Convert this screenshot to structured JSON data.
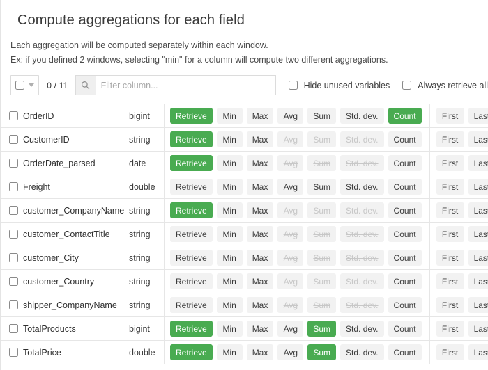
{
  "header": {
    "title": "Compute aggregations for each field",
    "subtitle_line1": "Each aggregation will be computed separately within each window.",
    "subtitle_line2": "Ex: if you defined 2 windows, selecting \"min\" for a column will compute two different aggregations."
  },
  "toolbar": {
    "select_all_checkbox_checked": false,
    "dropdown_icon": "chevron-down-icon",
    "count_label": "0 / 11",
    "search_icon": "search-icon",
    "search_placeholder": "Filter column...",
    "search_value": "",
    "hide_unused_label": "Hide unused variables",
    "hide_unused_checked": false,
    "always_retrieve_label": "Always retrieve all",
    "always_retrieve_checked": false
  },
  "colors": {
    "accent_green": "#49ab51",
    "button_bg": "#f2f2f2",
    "button_text": "#3b3b3b",
    "disabled_text": "#c7c7c7",
    "border": "#e6e6e6"
  },
  "action_labels": {
    "retrieve": "Retrieve",
    "min": "Min",
    "max": "Max",
    "avg": "Avg",
    "sum": "Sum",
    "std": "Std. dev.",
    "count": "Count",
    "first": "First",
    "last": "Last"
  },
  "rows": [
    {
      "name": "OrderID",
      "type": "bigint",
      "checked": false,
      "actions": {
        "retrieve": "selected",
        "min": "normal",
        "max": "normal",
        "avg": "normal",
        "sum": "normal",
        "std": "normal",
        "count": "selected",
        "first": "normal",
        "last": "normal"
      }
    },
    {
      "name": "CustomerID",
      "type": "string",
      "checked": false,
      "actions": {
        "retrieve": "selected",
        "min": "normal",
        "max": "normal",
        "avg": "disabled",
        "sum": "disabled",
        "std": "disabled",
        "count": "normal",
        "first": "normal",
        "last": "normal"
      }
    },
    {
      "name": "OrderDate_parsed",
      "type": "date",
      "checked": false,
      "actions": {
        "retrieve": "selected",
        "min": "normal",
        "max": "normal",
        "avg": "disabled",
        "sum": "disabled",
        "std": "disabled",
        "count": "normal",
        "first": "normal",
        "last": "normal"
      }
    },
    {
      "name": "Freight",
      "type": "double",
      "checked": false,
      "actions": {
        "retrieve": "normal",
        "min": "normal",
        "max": "normal",
        "avg": "normal",
        "sum": "normal",
        "std": "normal",
        "count": "normal",
        "first": "normal",
        "last": "normal"
      }
    },
    {
      "name": "customer_CompanyName",
      "type": "string",
      "checked": false,
      "actions": {
        "retrieve": "selected",
        "min": "normal",
        "max": "normal",
        "avg": "disabled",
        "sum": "disabled",
        "std": "disabled",
        "count": "normal",
        "first": "normal",
        "last": "normal"
      }
    },
    {
      "name": "customer_ContactTitle",
      "type": "string",
      "checked": false,
      "actions": {
        "retrieve": "normal",
        "min": "normal",
        "max": "normal",
        "avg": "disabled",
        "sum": "disabled",
        "std": "disabled",
        "count": "normal",
        "first": "normal",
        "last": "normal"
      }
    },
    {
      "name": "customer_City",
      "type": "string",
      "checked": false,
      "actions": {
        "retrieve": "normal",
        "min": "normal",
        "max": "normal",
        "avg": "disabled",
        "sum": "disabled",
        "std": "disabled",
        "count": "normal",
        "first": "normal",
        "last": "normal"
      }
    },
    {
      "name": "customer_Country",
      "type": "string",
      "checked": false,
      "actions": {
        "retrieve": "normal",
        "min": "normal",
        "max": "normal",
        "avg": "disabled",
        "sum": "disabled",
        "std": "disabled",
        "count": "normal",
        "first": "normal",
        "last": "normal"
      }
    },
    {
      "name": "shipper_CompanyName",
      "type": "string",
      "checked": false,
      "actions": {
        "retrieve": "normal",
        "min": "normal",
        "max": "normal",
        "avg": "disabled",
        "sum": "disabled",
        "std": "disabled",
        "count": "normal",
        "first": "normal",
        "last": "normal"
      }
    },
    {
      "name": "TotalProducts",
      "type": "bigint",
      "checked": false,
      "actions": {
        "retrieve": "selected",
        "min": "normal",
        "max": "normal",
        "avg": "normal",
        "sum": "selected",
        "std": "normal",
        "count": "normal",
        "first": "normal",
        "last": "normal"
      }
    },
    {
      "name": "TotalPrice",
      "type": "double",
      "checked": false,
      "actions": {
        "retrieve": "selected",
        "min": "normal",
        "max": "normal",
        "avg": "normal",
        "sum": "selected",
        "std": "normal",
        "count": "normal",
        "first": "normal",
        "last": "normal"
      }
    }
  ]
}
